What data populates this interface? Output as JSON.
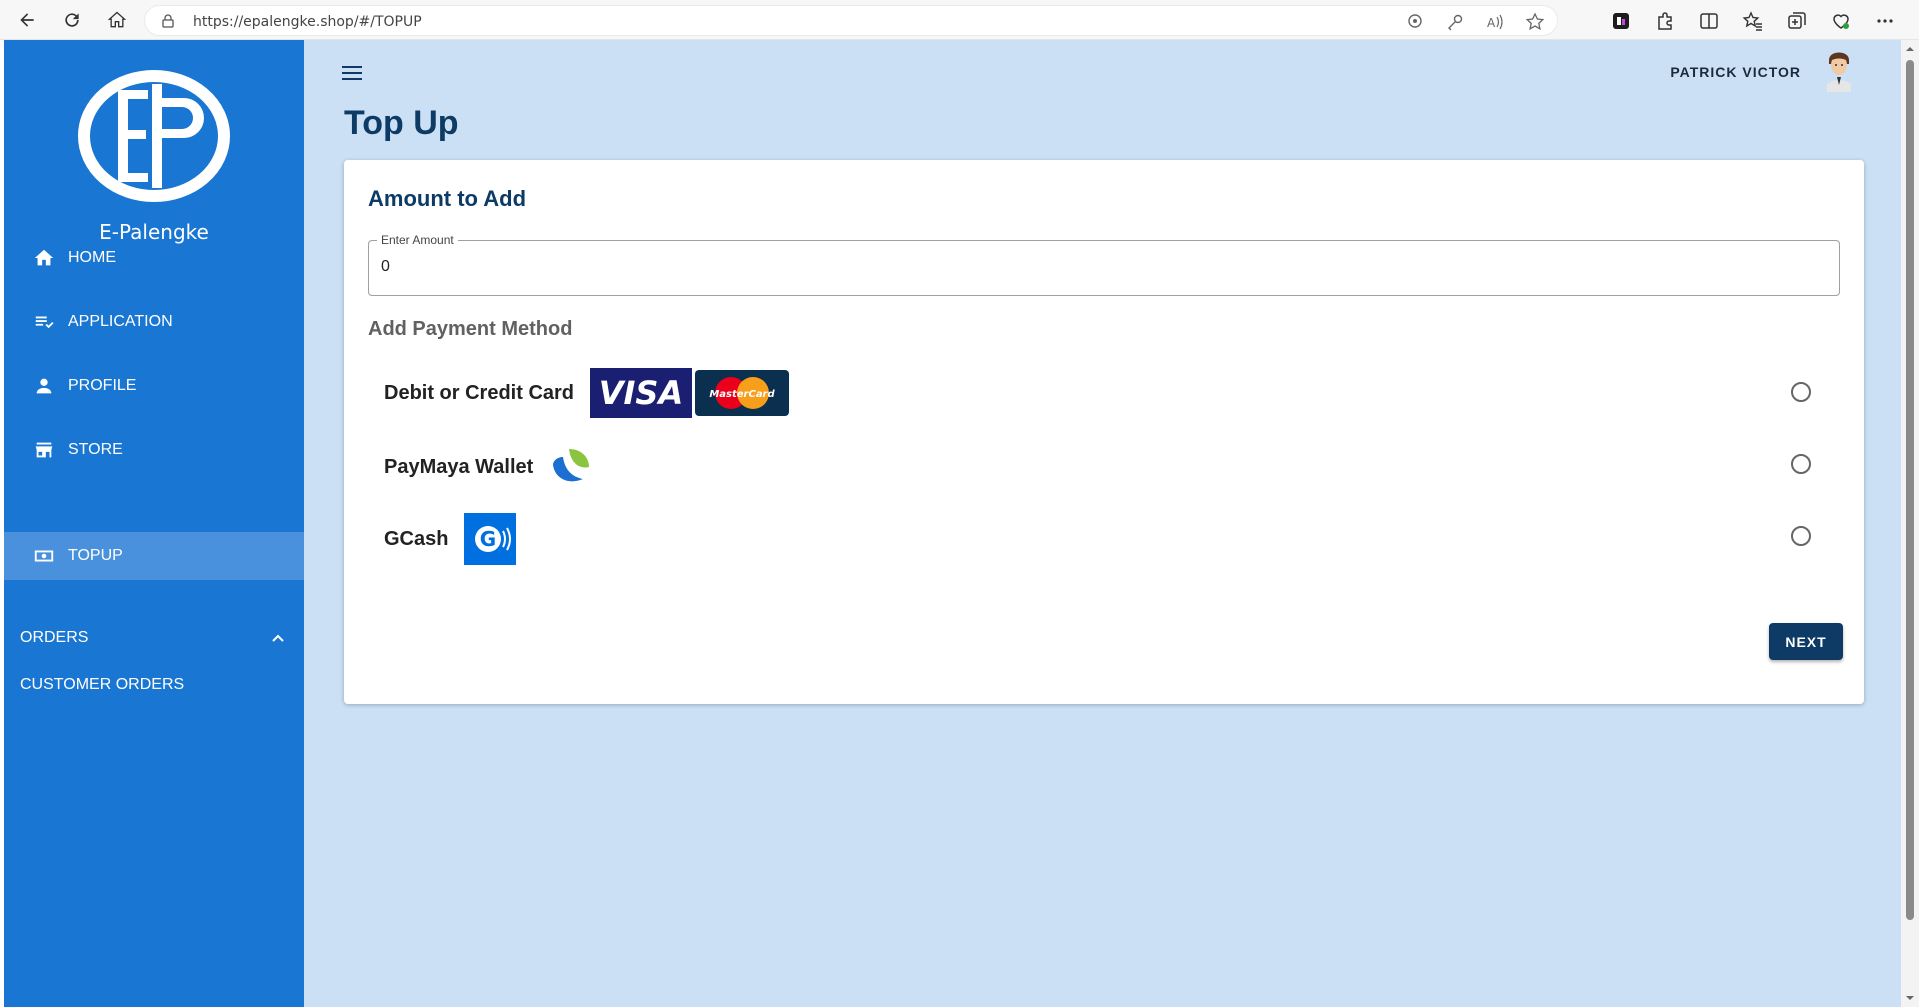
{
  "browser": {
    "url": "https://epalengke.shop/#/TOPUP"
  },
  "sidebar": {
    "brand": "E-Palengke",
    "items": [
      {
        "label": "HOME",
        "icon": "home-icon"
      },
      {
        "label": "APPLICATION",
        "icon": "playlist-check-icon"
      },
      {
        "label": "PROFILE",
        "icon": "person-icon"
      },
      {
        "label": "STORE",
        "icon": "store-icon"
      },
      {
        "label": "TOPUP",
        "icon": "cash-icon",
        "active": true
      }
    ],
    "orders_section": {
      "label": "ORDERS",
      "expanded": true,
      "items": [
        "CUSTOMER ORDERS"
      ]
    }
  },
  "header": {
    "user_name": "PATRICK VICTOR"
  },
  "page": {
    "title": "Top Up",
    "card_title": "Amount to Add",
    "amount_label": "Enter Amount",
    "amount_value": "0",
    "payment_title": "Add Payment Method",
    "methods": [
      {
        "label": "Debit or Credit Card",
        "logos": [
          "VISA",
          "MasterCard"
        ],
        "selected": false
      },
      {
        "label": "PayMaya Wallet",
        "logos": [
          "paymaya-logo"
        ],
        "selected": false
      },
      {
        "label": "GCash",
        "logos": [
          "gcash-logo"
        ],
        "selected": false
      }
    ],
    "next_label": "NEXT"
  },
  "colors": {
    "sidebar": "#1976d2",
    "sidebar_active": "#4a91dd",
    "main_bg": "#cbe0f5",
    "primary_dark": "#0d3b66"
  }
}
